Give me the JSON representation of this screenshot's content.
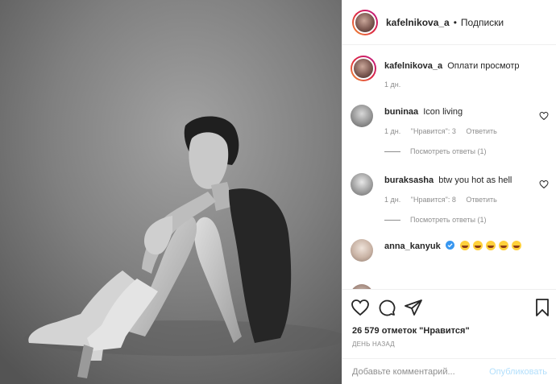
{
  "header": {
    "username": "kafelnikova_a",
    "separator": "•",
    "follow_label": "Подписки"
  },
  "caption": {
    "username": "kafelnikova_a",
    "text": "Оплати просмотр",
    "time": "1 дн."
  },
  "comments": [
    {
      "username": "buninaa",
      "text": "Icon living",
      "time": "1 дн.",
      "likes": "\"Нравится\": 3",
      "reply": "Ответить",
      "view_replies": "Посмотреть ответы (1)"
    },
    {
      "username": "buraksasha",
      "text": "btw you hot as hell",
      "time": "1 дн.",
      "likes": "\"Нравится\": 8",
      "reply": "Ответить",
      "view_replies": "Посмотреть ответы (1)"
    },
    {
      "username": "anna_kanyuk",
      "verified": true,
      "emoji_count": 5,
      "emoji_icon": "laughing-tears-emoji"
    }
  ],
  "actions": {
    "likes": "26 579 отметок \"Нравится\"",
    "time": "ДЕНЬ НАЗАД"
  },
  "add_comment": {
    "placeholder": "Добавьте комментарий...",
    "publish_label": "Опубликовать"
  },
  "colors": {
    "verified": "#3897f0",
    "publish_disabled": "#b2dffc",
    "muted": "#8e8e8e"
  }
}
